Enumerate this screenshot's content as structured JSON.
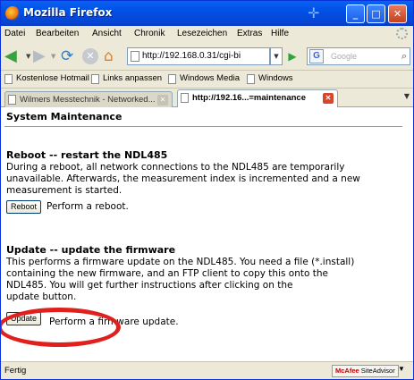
{
  "window": {
    "title": "Mozilla Firefox",
    "minimize": "_",
    "maximize": "□",
    "close": "✕"
  },
  "menu": [
    "Datei",
    "Bearbeiten",
    "Ansicht",
    "Chronik",
    "Lesezeichen",
    "Extras",
    "Hilfe"
  ],
  "navbar": {
    "url": "http://192.168.0.31/cgi-bi",
    "search_placeholder": "Google",
    "search_engine_glyph": "G"
  },
  "bookmarks": [
    "Kostenlose Hotmail",
    "Links anpassen",
    "Windows Media",
    "Windows"
  ],
  "tabs": [
    {
      "label": "Wilmers Messtechnik - Networked...",
      "active": false
    },
    {
      "label": "http://192.16...=maintenance",
      "active": true
    }
  ],
  "page": {
    "title": "System Maintenance",
    "reboot": {
      "heading": "Reboot -- restart the NDL485",
      "line1": "During a reboot, all network connections to the NDL485 are temporarily",
      "line2": "unavailable. Afterwards, the measurement index is incremented and a new",
      "line3": "measurement is started.",
      "button": "Reboot",
      "action": "Perform a reboot."
    },
    "update": {
      "heading": "Update -- update the firmware",
      "line1": "This performs a firmware update on the NDL485. You need a file (*.install)",
      "line2": "containing the new firmware, and an FTP client to copy this onto the",
      "line3": "NDL485. You will get further instructions after clicking on the",
      "line4": "update button.",
      "button": "Update",
      "action": "Perform a firmware update."
    }
  },
  "statusbar": {
    "status": "Fertig",
    "addon_brand": "McAfee",
    "addon_name": "SiteAdvisor"
  },
  "colors": {
    "titlebar": "#0050e6",
    "highlight_circle": "#e0201c",
    "tab_close_active": "#d9442c"
  }
}
